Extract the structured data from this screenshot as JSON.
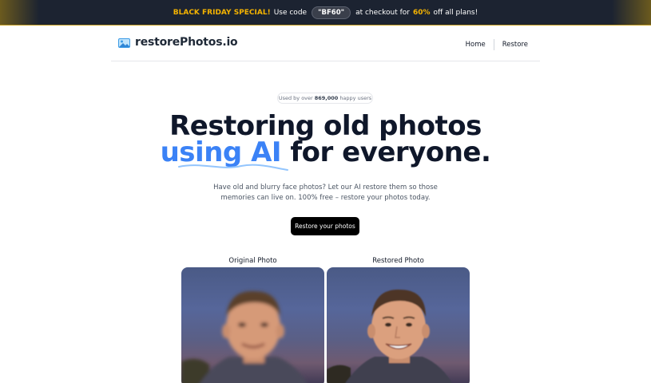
{
  "promo": {
    "headline": "BLACK FRIDAY SPECIAL!",
    "text_before_code": "Use code",
    "code": "\"BF60\"",
    "text_after_code": "at checkout for",
    "percent": "60%",
    "text_end": "off all plans!"
  },
  "header": {
    "logo_text": "restorePhotos.io",
    "nav": [
      "Home",
      "Restore"
    ]
  },
  "hero": {
    "pill_prefix": "Used by over",
    "pill_count": "869,000",
    "pill_suffix": "happy users",
    "title_line1": "Restoring old photos",
    "title_line2_highlight": "using AI",
    "title_line2_rest": "for everyone.",
    "description_line1": "Have old and blurry face photos? Let our AI restore them so those",
    "description_line2": "memories can live on. 100% free – restore your photos today.",
    "cta_label": "Restore your photos"
  },
  "photos": {
    "original_label": "Original Photo",
    "restored_label": "Restored Photo"
  },
  "colors": {
    "accent_blue": "#3b82f6",
    "promo_gold": "#f5b301",
    "promo_bg": "#1c2331"
  }
}
